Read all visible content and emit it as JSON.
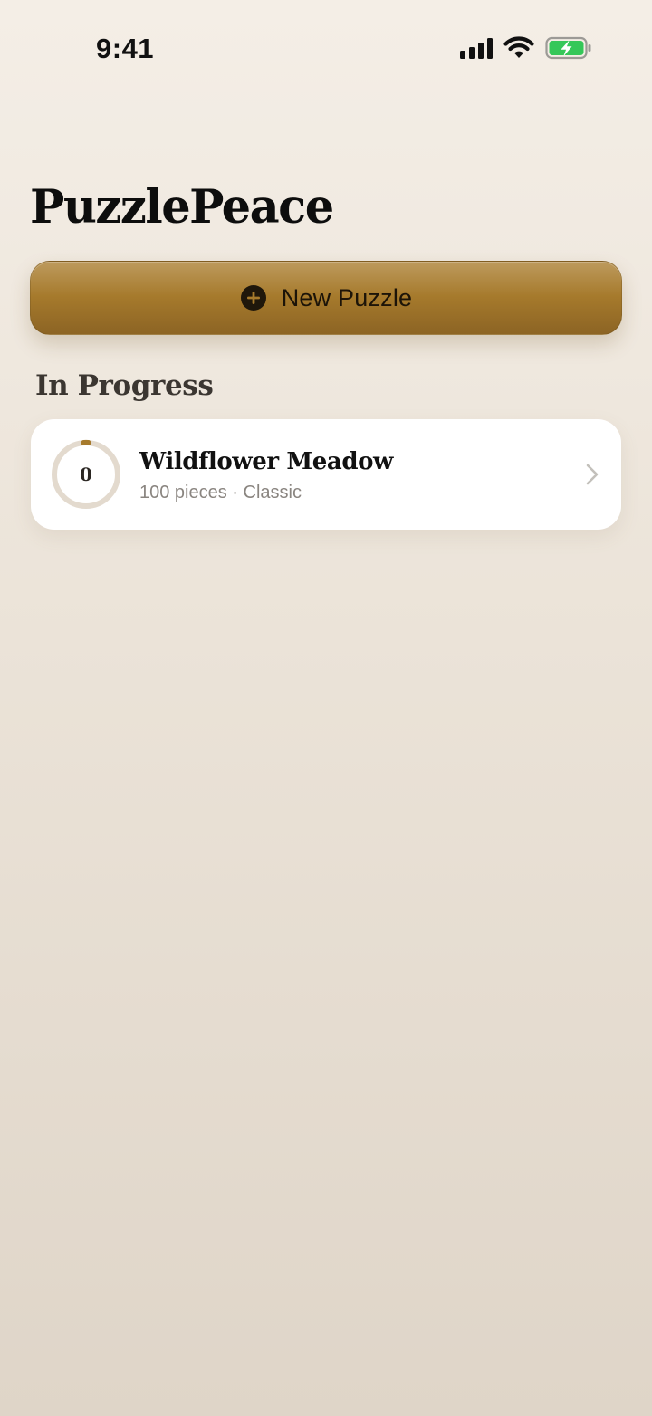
{
  "status_bar": {
    "time": "9:41",
    "icons": [
      "cellular-signal-icon",
      "wifi-icon",
      "battery-charging-icon"
    ],
    "battery_color": "#35c759"
  },
  "header": {
    "title": "PuzzlePeace"
  },
  "actions": {
    "new_puzzle_label": "New Puzzle",
    "new_puzzle_icon": "plus-circle-icon",
    "accent_color": "#a67a2c"
  },
  "in_progress": {
    "section_title": "In Progress",
    "items": [
      {
        "name": "Wildflower Meadow",
        "meta": "100 pieces · Classic",
        "progress_label": "0",
        "progress_fraction": 0.0,
        "icon": "chevron-right-icon"
      }
    ]
  }
}
